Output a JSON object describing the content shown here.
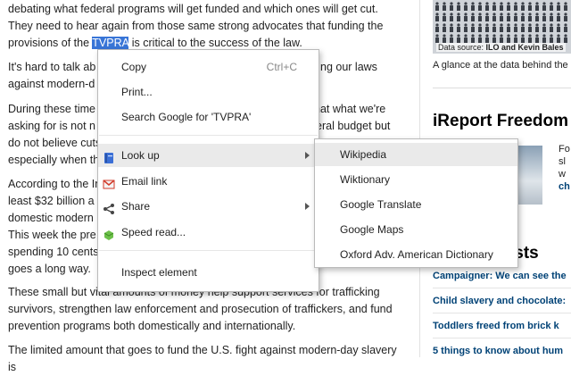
{
  "article": {
    "p1_before": "debating what federal programs will get funded and which ones will get cut. They need to hear again from those same strong advocates that funding the provisions of the ",
    "p1_highlight": "TVPRA",
    "p1_after": " is critical to the success of the law.",
    "p2_a": "It's hard to talk ab",
    "p2_b": "against modern-d",
    "p2_right": "ng our laws",
    "p3_a": "During these time",
    "p3_a_right": "hat what we're",
    "p3_b": "asking for is not n",
    "p3_b_right": "eral budget but",
    "p3_c": "do not believe cuts",
    "p3_d": "especially when th",
    "p4_a": "According to the In",
    "p4_b": "least $32 billion a",
    "p4_c": "domestic modern",
    "p4_d": "This week the pre",
    "p4_e": "spending 10 cents",
    "p4_f": "goes a long way.",
    "p5": "These small but vital amounts of money help support services for trafficking survivors, strengthen law enforcement and prosecution of traffickers, and fund prevention programs both domestically and internationally.",
    "p6": "The limited amount that goes to fund the U.S. fight against modern-day slavery is"
  },
  "sidebar": {
    "datasource_label": "Data source: ",
    "datasource_value": "ILO and Kevin Bales",
    "caption": "A glance at the data behind the p",
    "ireport_title": "iReport Freedom P",
    "ireport_text": [
      "Fo",
      "sl",
      "w",
      "ch"
    ],
    "lists_title": "ists",
    "links": [
      "Campaigner: We can see the",
      "Child slavery and chocolate:",
      "Toddlers freed from brick k",
      "5 things to know about hum"
    ]
  },
  "context_menu": {
    "items": [
      {
        "label": "Copy",
        "shortcut": "Ctrl+C"
      },
      {
        "label": "Print..."
      },
      {
        "label": "Search Google for 'TVPRA'"
      },
      {
        "label": "Look up"
      },
      {
        "label": "Email link"
      },
      {
        "label": "Share"
      },
      {
        "label": "Speed read..."
      },
      {
        "label": "Inspect element"
      }
    ]
  },
  "submenu": {
    "items": [
      "Wikipedia",
      "Wiktionary",
      "Google Translate",
      "Google Maps",
      "Oxford Adv. American Dictionary"
    ]
  },
  "colors": {
    "selection": "#3875d7",
    "link": "#004276",
    "lookup_icon": "#3b6fd6",
    "email_icon": "#d23a2a",
    "speedread_icon": "#6cc04a"
  }
}
